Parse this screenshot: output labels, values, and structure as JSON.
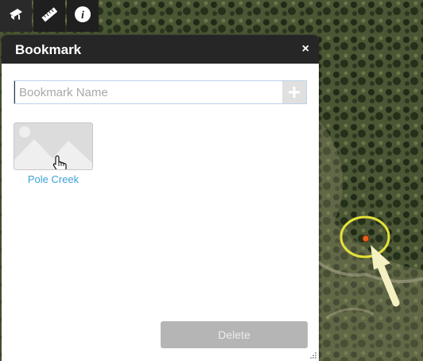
{
  "toolbar": {
    "items": [
      {
        "icon": "bookmark-tool-icon"
      },
      {
        "icon": "measure-ruler-icon"
      },
      {
        "icon": "info-icon",
        "glyph": "i"
      }
    ]
  },
  "bookmark_panel": {
    "title": "Bookmark",
    "close_glyph": "×",
    "input": {
      "value": "",
      "placeholder": "Bookmark Name"
    },
    "add_glyph": "+",
    "bookmarks": [
      {
        "label": "Pole Creek",
        "thumbnail": "image-placeholder-icon"
      }
    ],
    "delete_label": "Delete"
  },
  "colors": {
    "header_bg": "#262626",
    "link": "#3c9fd8",
    "delete_disabled": "#b5b5b5",
    "highlight_circle": "#e6e23a",
    "marker": "#e8621a",
    "arrow": "#f4f0c2"
  }
}
